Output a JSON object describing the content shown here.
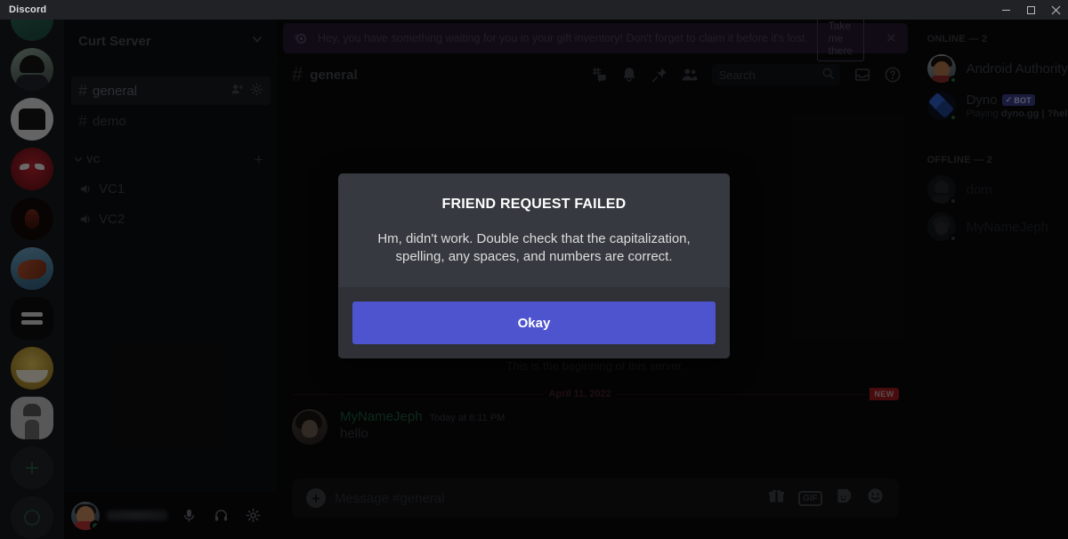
{
  "window": {
    "title": "Discord",
    "minimize": "—",
    "maximize": "□",
    "close": "✕"
  },
  "rail": {
    "guilds": [
      {
        "name": "server-mint",
        "color1": "#2f6f5e",
        "color2": "#1d4a3e",
        "active": false
      },
      {
        "name": "server-band",
        "color1": "#8ea598",
        "color2": "#3f4a44",
        "active": false
      },
      {
        "name": "server-monstercat",
        "color1": "#e8e8e8",
        "color2": "#cfcfcf",
        "active": false
      },
      {
        "name": "server-spiderman",
        "color1": "#b8202a",
        "color2": "#6d1016",
        "active": false
      },
      {
        "name": "server-flame",
        "color1": "#3a1a12",
        "color2": "#1a0d0a",
        "active": false
      },
      {
        "name": "server-art",
        "color1": "#5a8fb5",
        "color2": "#b5532f",
        "active": false
      },
      {
        "name": "server-dark",
        "color1": "#1a1a1a",
        "color2": "#0d0d0d",
        "active": true
      },
      {
        "name": "server-food",
        "color1": "#d9b23c",
        "color2": "#9a7a22",
        "active": false
      },
      {
        "name": "server-sketch",
        "color1": "#b9b9b9",
        "color2": "#8d8d8d",
        "active": false
      }
    ],
    "add_server": "+",
    "explore": "compass"
  },
  "sidebar": {
    "guild_name": "Curt Server",
    "channels": [
      {
        "type": "text",
        "name": "general",
        "active": true
      },
      {
        "type": "text",
        "name": "demo",
        "active": false
      }
    ],
    "category": {
      "label": "VC",
      "add": "+"
    },
    "voice_channels": [
      {
        "name": "VC1"
      },
      {
        "name": "VC2"
      }
    ]
  },
  "user_panel": {
    "username": "",
    "buttons": [
      "mute-button",
      "deafen-button",
      "user-settings-button"
    ]
  },
  "banner": {
    "text": "Hey, you have something waiting for you in your gift inventory! Don't forget to claim it before it's lost.",
    "button": "Take me there",
    "close": "✕"
  },
  "channel_header": {
    "hash": "#",
    "title": "general",
    "icons": [
      "threads-icon",
      "notifications-icon",
      "pinned-messages-icon",
      "member-list-icon"
    ]
  },
  "search": {
    "placeholder": "Search"
  },
  "header_right": {
    "inbox": "inbox-icon",
    "help": "help-icon"
  },
  "chat": {
    "welcome": "This is the beginning of this server.",
    "divider_date": "April 11, 2022",
    "new_badge": "NEW",
    "messages": [
      {
        "author": "MyNameJeph",
        "timestamp": "Today at 6:11 PM",
        "text": "hello"
      }
    ]
  },
  "composer": {
    "placeholder": "Message #general",
    "plus": "+",
    "gif_label": "GIF",
    "icons": [
      "gift-icon",
      "gif-icon",
      "sticker-icon",
      "emoji-icon"
    ]
  },
  "members": {
    "online_header": "ONLINE — 2",
    "offline_header": "OFFLINE — 2",
    "online": [
      {
        "name": "Android Authority",
        "crown": "♛",
        "bot": false,
        "activity": "",
        "activity_bold": "",
        "activity_suffix": ""
      },
      {
        "name": "Dyno",
        "crown": "",
        "bot": true,
        "bot_label": "BOT",
        "bot_check": "✓",
        "activity_prefix": "Playing ",
        "activity_bold": "dyno.gg | ?help",
        "activity_suffix": ""
      }
    ],
    "offline": [
      {
        "name": "dom"
      },
      {
        "name": "MyNameJeph"
      }
    ]
  },
  "modal": {
    "title": "FRIEND REQUEST FAILED",
    "description": "Hm, didn't work. Double check that the capitalization, spelling, any spaces, and numbers are correct.",
    "button": "Okay",
    "accent_color": "#4e54cd"
  }
}
